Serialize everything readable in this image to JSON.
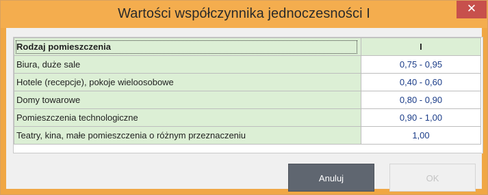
{
  "window": {
    "title": "Wartości współczynnika jednoczesności I",
    "close_glyph": "✕"
  },
  "table": {
    "headers": [
      "Rodzaj pomieszczenia",
      "I"
    ],
    "rows": [
      {
        "name": "Biura, duże sale",
        "value": "0,75 - 0,95"
      },
      {
        "name": "Hotele (recepcje), pokoje wieloosobowe",
        "value": "0,40 - 0,60"
      },
      {
        "name": "Domy towarowe",
        "value": "0,80 - 0,90"
      },
      {
        "name": "Pomieszczenia technologiczne",
        "value": "0,90 - 1,00"
      },
      {
        "name": "Teatry, kina, małe pomieszczenia o różnym przeznaczeniu",
        "value": "1,00"
      }
    ]
  },
  "buttons": {
    "cancel_label": "Anuluj",
    "ok_label": "OK"
  },
  "colors": {
    "title_bar": "#f4ad4e",
    "close_button": "#c7504c",
    "name_cell": "#dcefd5",
    "value_text": "#1a3c88",
    "cancel_button": "#5f6670"
  }
}
